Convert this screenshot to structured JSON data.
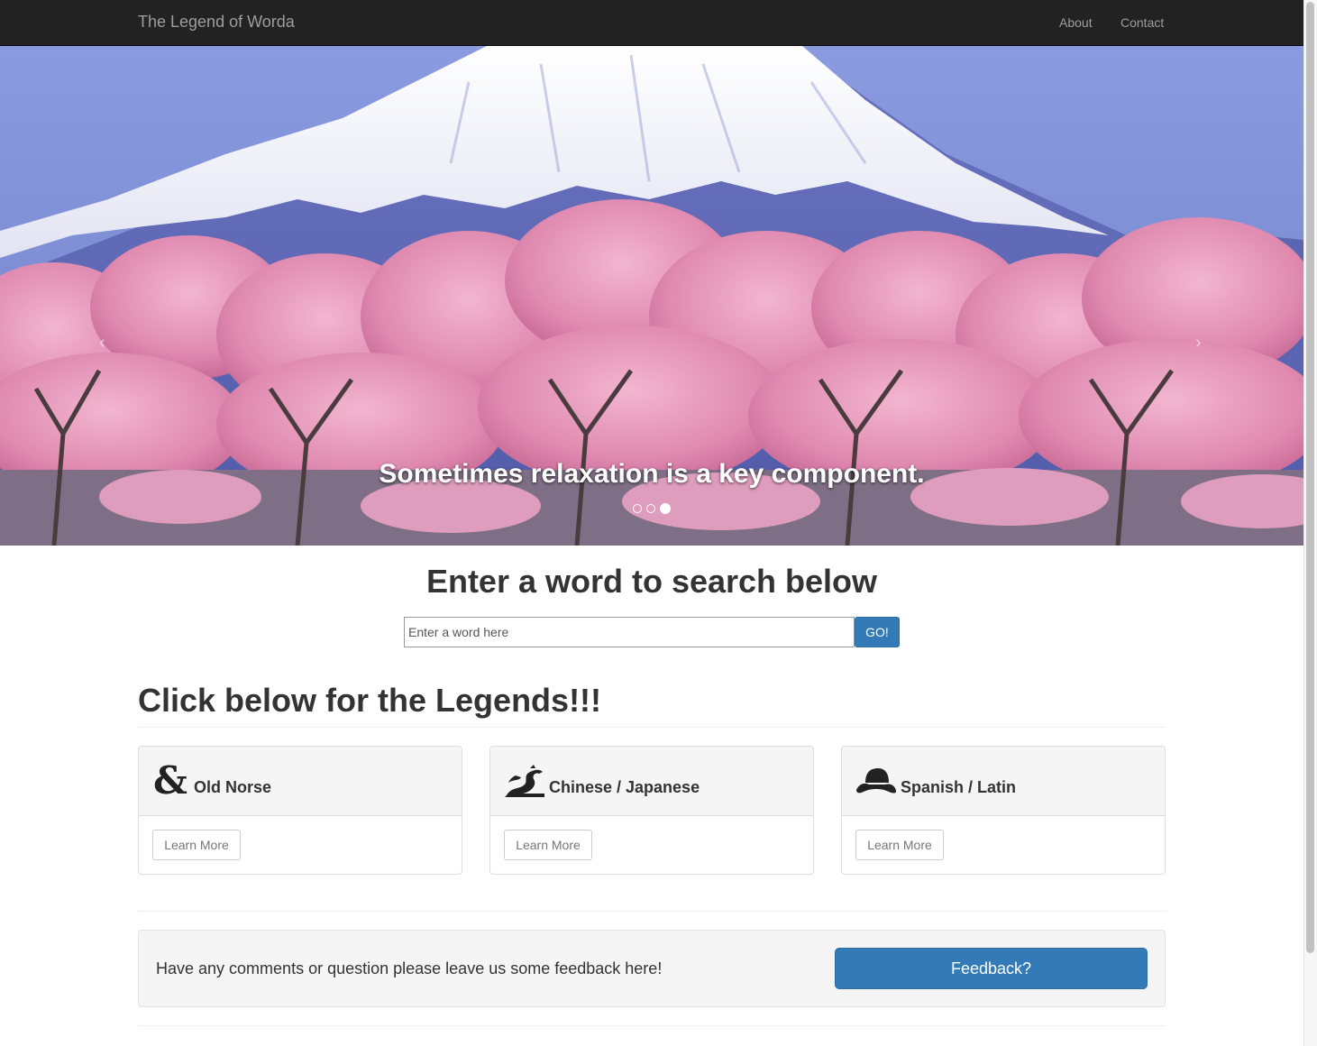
{
  "navbar": {
    "brand": "The Legend of Worda",
    "links": [
      "About",
      "Contact"
    ]
  },
  "carousel": {
    "caption": "Sometimes relaxation is a key component.",
    "prev_glyph": "‹",
    "next_glyph": "›",
    "slide_count": 3,
    "active_slide": 3
  },
  "search": {
    "title": "Enter a word to search below",
    "placeholder": "Enter a word here",
    "button_label": "GO!"
  },
  "legends": {
    "heading": "Click below for the Legends!!!",
    "panels": [
      {
        "title": "Old Norse",
        "icon": "ampersand-icon",
        "button_label": "Learn More"
      },
      {
        "title": "Chinese / Japanese",
        "icon": "dragon-icon",
        "button_label": "Learn More"
      },
      {
        "title": "Spanish / Latin",
        "icon": "sombrero-icon",
        "button_label": "Learn More"
      }
    ]
  },
  "feedback": {
    "text": "Have any comments or question please leave us some feedback here!",
    "button_label": "Feedback?"
  },
  "colors": {
    "navbar_bg": "#222222",
    "primary": "#337ab7",
    "panel_head_bg": "#f5f5f5"
  }
}
